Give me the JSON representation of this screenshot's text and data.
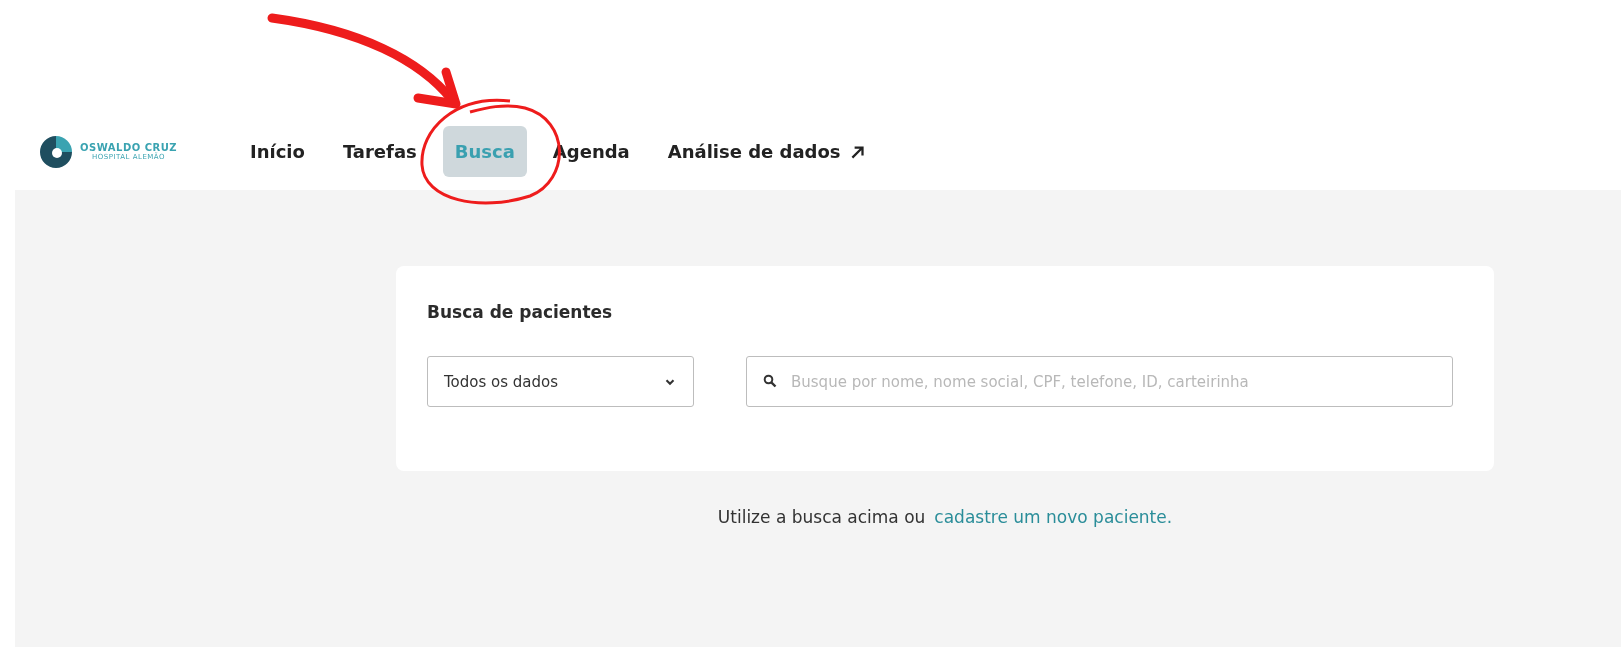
{
  "logo": {
    "name": "OSWALDO CRUZ",
    "subtitle": "HOSPITAL ALEMÃO"
  },
  "nav": [
    {
      "label": "Início",
      "selected": false,
      "external": false
    },
    {
      "label": "Tarefas",
      "selected": false,
      "external": false
    },
    {
      "label": "Busca",
      "selected": true,
      "external": false
    },
    {
      "label": "Agenda",
      "selected": false,
      "external": false
    },
    {
      "label": "Análise de dados",
      "selected": false,
      "external": true
    }
  ],
  "search_card": {
    "title": "Busca de pacientes",
    "filter": {
      "value": "Todos os dados"
    },
    "search": {
      "placeholder": "Busque por nome, nome social, CPF, telefone, ID, carteirinha"
    }
  },
  "hint": {
    "text": "Utilize a busca acima ou",
    "link": "cadastre um novo paciente",
    "end": "."
  }
}
